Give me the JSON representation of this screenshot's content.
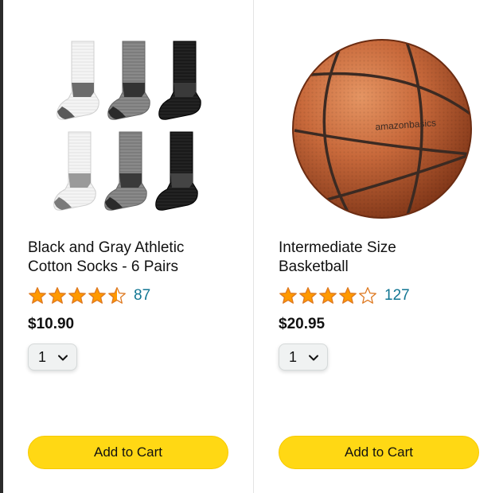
{
  "colors": {
    "star": "#ff9900",
    "link": "#127693",
    "button": "#ffd814",
    "divider": "#e3e3e3"
  },
  "products": [
    {
      "title_line1": "Black and Gray Athletic",
      "title_line2": "Cotton Socks - 6 Pairs",
      "rating": 4.5,
      "review_count": "87",
      "price": "$10.90",
      "quantity": "1",
      "image_icon": "socks-image",
      "button_label": "Add to Cart"
    },
    {
      "title_line1": "Intermediate Size",
      "title_line2": "Basketball",
      "rating": 4.0,
      "review_count": "127",
      "price": "$20.95",
      "quantity": "1",
      "image_icon": "basketball-image",
      "ball_brand_text": "amazonbasics",
      "button_label": "Add to Cart"
    }
  ]
}
